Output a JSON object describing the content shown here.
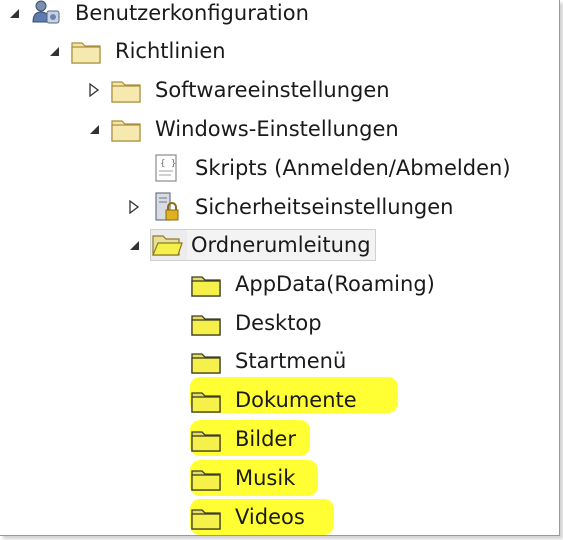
{
  "tree": {
    "user_config": {
      "label": "Benutzerkonfiguration",
      "expanded": true,
      "icon": "user-config-icon"
    },
    "policies": {
      "label": "Richtlinien",
      "expanded": true,
      "icon": "folder-icon"
    },
    "software_settings": {
      "label": "Softwareeinstellungen",
      "expanded": false,
      "icon": "folder-icon"
    },
    "windows_settings": {
      "label": "Windows-Einstellungen",
      "expanded": true,
      "icon": "folder-icon"
    },
    "scripts": {
      "label": "Skripts (Anmelden/Abmelden)",
      "icon": "script-icon"
    },
    "security_settings": {
      "label": "Sicherheitseinstellungen",
      "expanded": false,
      "icon": "security-icon"
    },
    "folder_redirection": {
      "label": "Ordnerumleitung",
      "expanded": true,
      "selected": true,
      "icon": "open-folder-icon",
      "children": [
        {
          "label": "AppData(Roaming)",
          "highlighted": false
        },
        {
          "label": "Desktop",
          "highlighted": false
        },
        {
          "label": "Startmenü",
          "highlighted": false
        },
        {
          "label": "Dokumente",
          "highlighted": true
        },
        {
          "label": "Bilder",
          "highlighted": true
        },
        {
          "label": "Musik",
          "highlighted": true
        },
        {
          "label": "Videos",
          "highlighted": true
        }
      ]
    }
  },
  "colors": {
    "highlight": "#ffff33",
    "folder_fill": "#f3e6a6",
    "folder_yellow": "#f6f04a",
    "text": "#1a1a1a"
  }
}
